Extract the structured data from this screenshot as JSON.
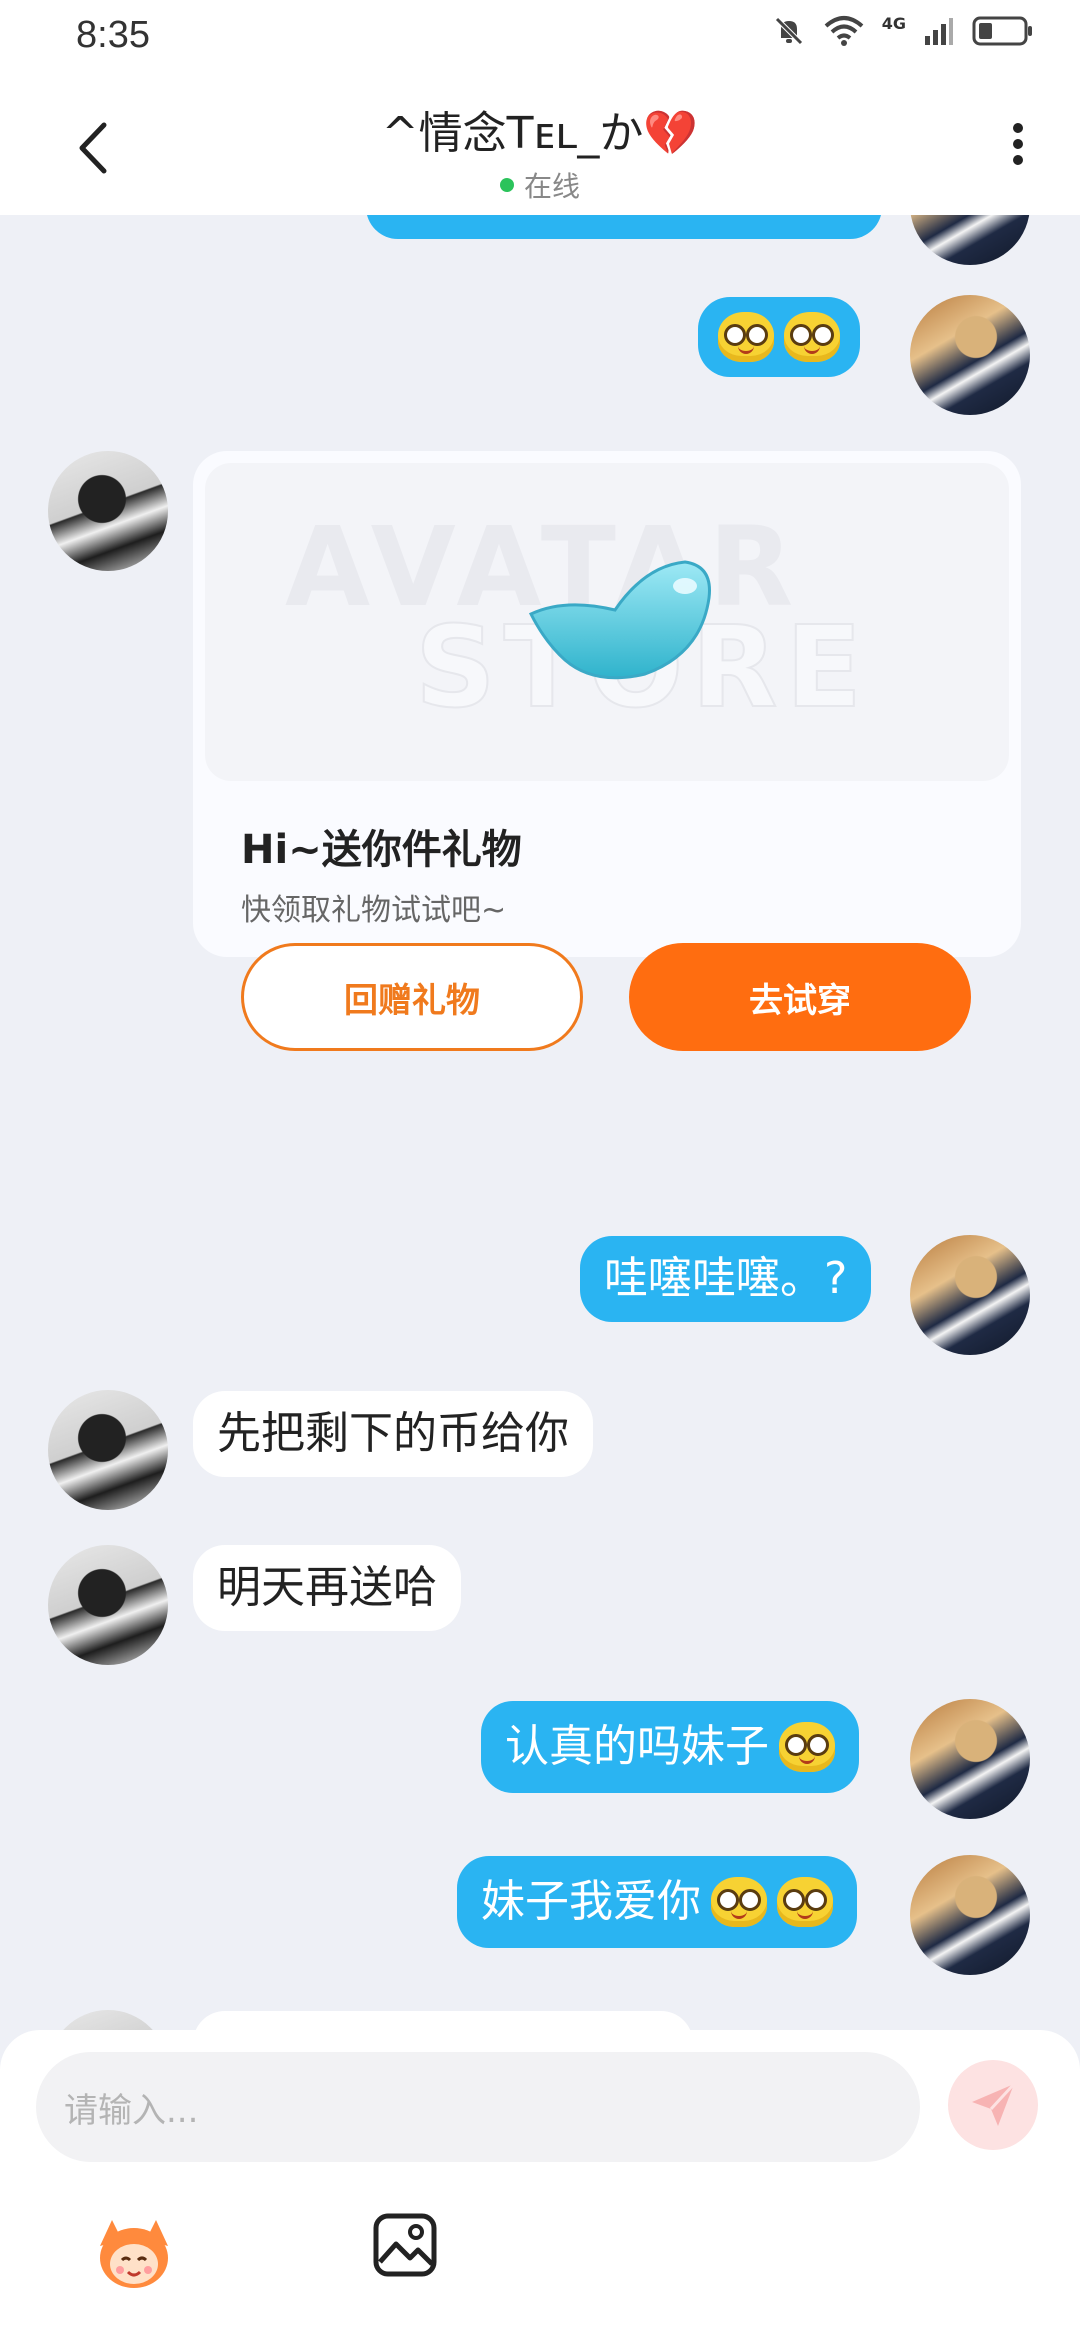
{
  "status_bar": {
    "time": "8:35",
    "network": "4G"
  },
  "header": {
    "contact_name": "^情念Tᴇʟ_か💔",
    "online_status": "在线",
    "back_icon": "chevron-left-icon",
    "more_icon": "more-vertical-icon"
  },
  "messages": [
    {
      "side": "me",
      "type": "emoji-only",
      "emojis": 2
    },
    {
      "side": "them",
      "type": "gift-card",
      "card": {
        "title": "Hi~送你件礼物",
        "subtitle": "快领取礼物试试吧~",
        "return_gift_label": "回赠礼物",
        "try_on_label": "去试穿"
      }
    },
    {
      "side": "me",
      "type": "text",
      "text": "哇噻哇噻。?"
    },
    {
      "side": "them",
      "type": "text",
      "text": "先把剩下的币给你"
    },
    {
      "side": "them",
      "type": "text",
      "text": "明天再送哈"
    },
    {
      "side": "me",
      "type": "text",
      "text": "认真的吗妹子",
      "emojis": 1
    },
    {
      "side": "me",
      "type": "text",
      "text": "妹子我爱你",
      "emojis": 2
    }
  ],
  "input": {
    "placeholder": "请输入..."
  },
  "colors": {
    "my_bubble": "#2ab4f2",
    "primary_button": "#ff6d10",
    "online_dot": "#2bc35b",
    "background": "#eef0f6"
  }
}
